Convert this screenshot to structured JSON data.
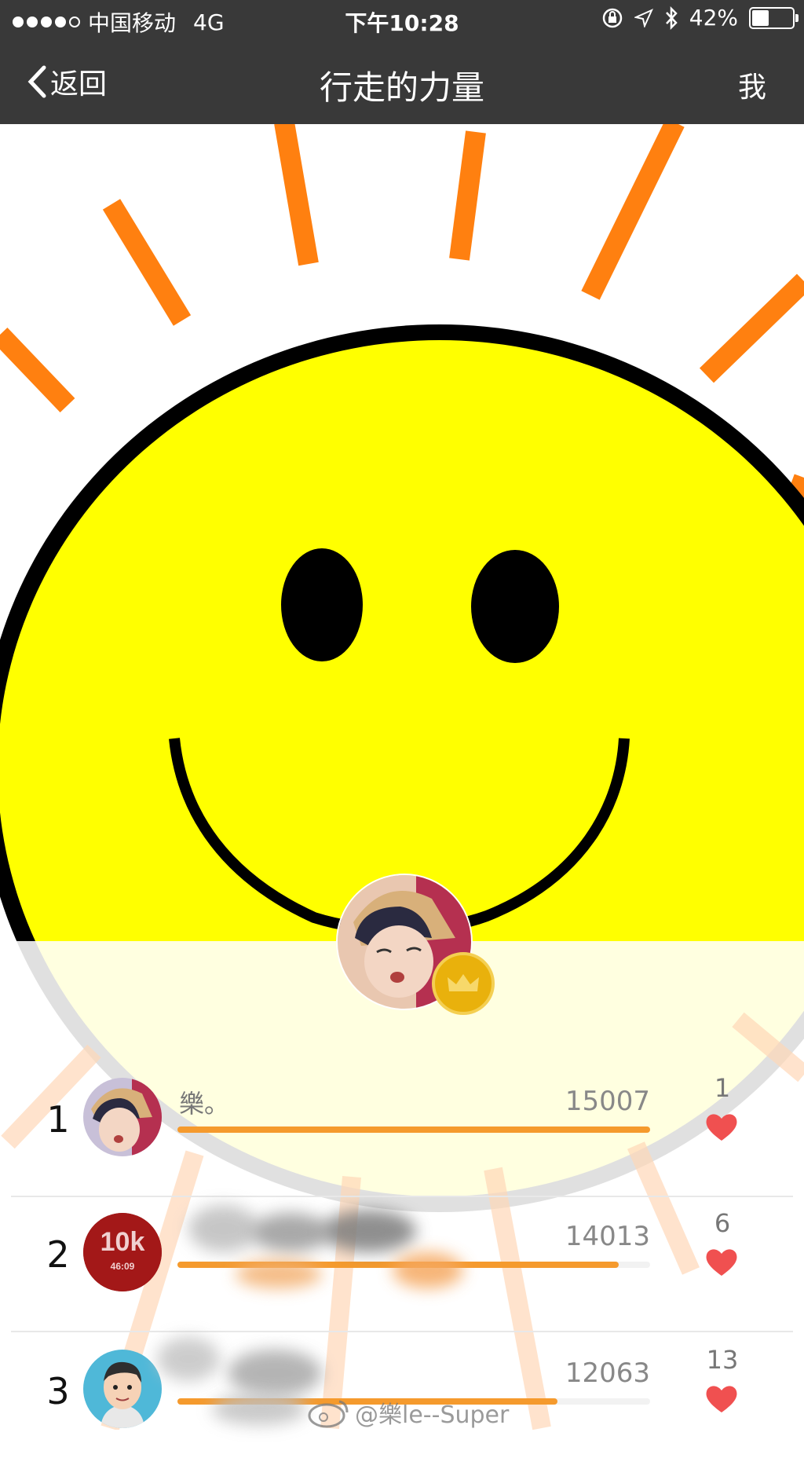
{
  "status_bar": {
    "carrier": "中国移动",
    "network": "4G",
    "time": "下午10:28",
    "battery_percent": "42%",
    "battery_level": 0.42
  },
  "nav": {
    "back_label": "返回",
    "title": "行走的力量",
    "me_label": "我"
  },
  "ranking": [
    {
      "rank": "1",
      "name": "樂。",
      "steps": "15007",
      "likes": "1",
      "progress": 1.0
    },
    {
      "rank": "2",
      "name": "",
      "steps": "14013",
      "likes": "6",
      "progress": 0.934
    },
    {
      "rank": "3",
      "name": "",
      "steps": "12063",
      "likes": "13",
      "progress": 0.804
    }
  ],
  "avatar_2_text": "10k",
  "avatar_2_subtext": "46:09",
  "watermark": "@樂le--Super",
  "colors": {
    "nav_bg": "#393939",
    "accent_orange": "#f59a2d",
    "heart_red": "#f05050",
    "crown_gold": "#e9b10c",
    "smiley_yellow": "#ffff00"
  },
  "icons": [
    "chevron-left-icon",
    "crown-icon",
    "heart-icon",
    "weibo-icon",
    "bluetooth-icon",
    "location-icon",
    "rotation-lock-icon"
  ]
}
